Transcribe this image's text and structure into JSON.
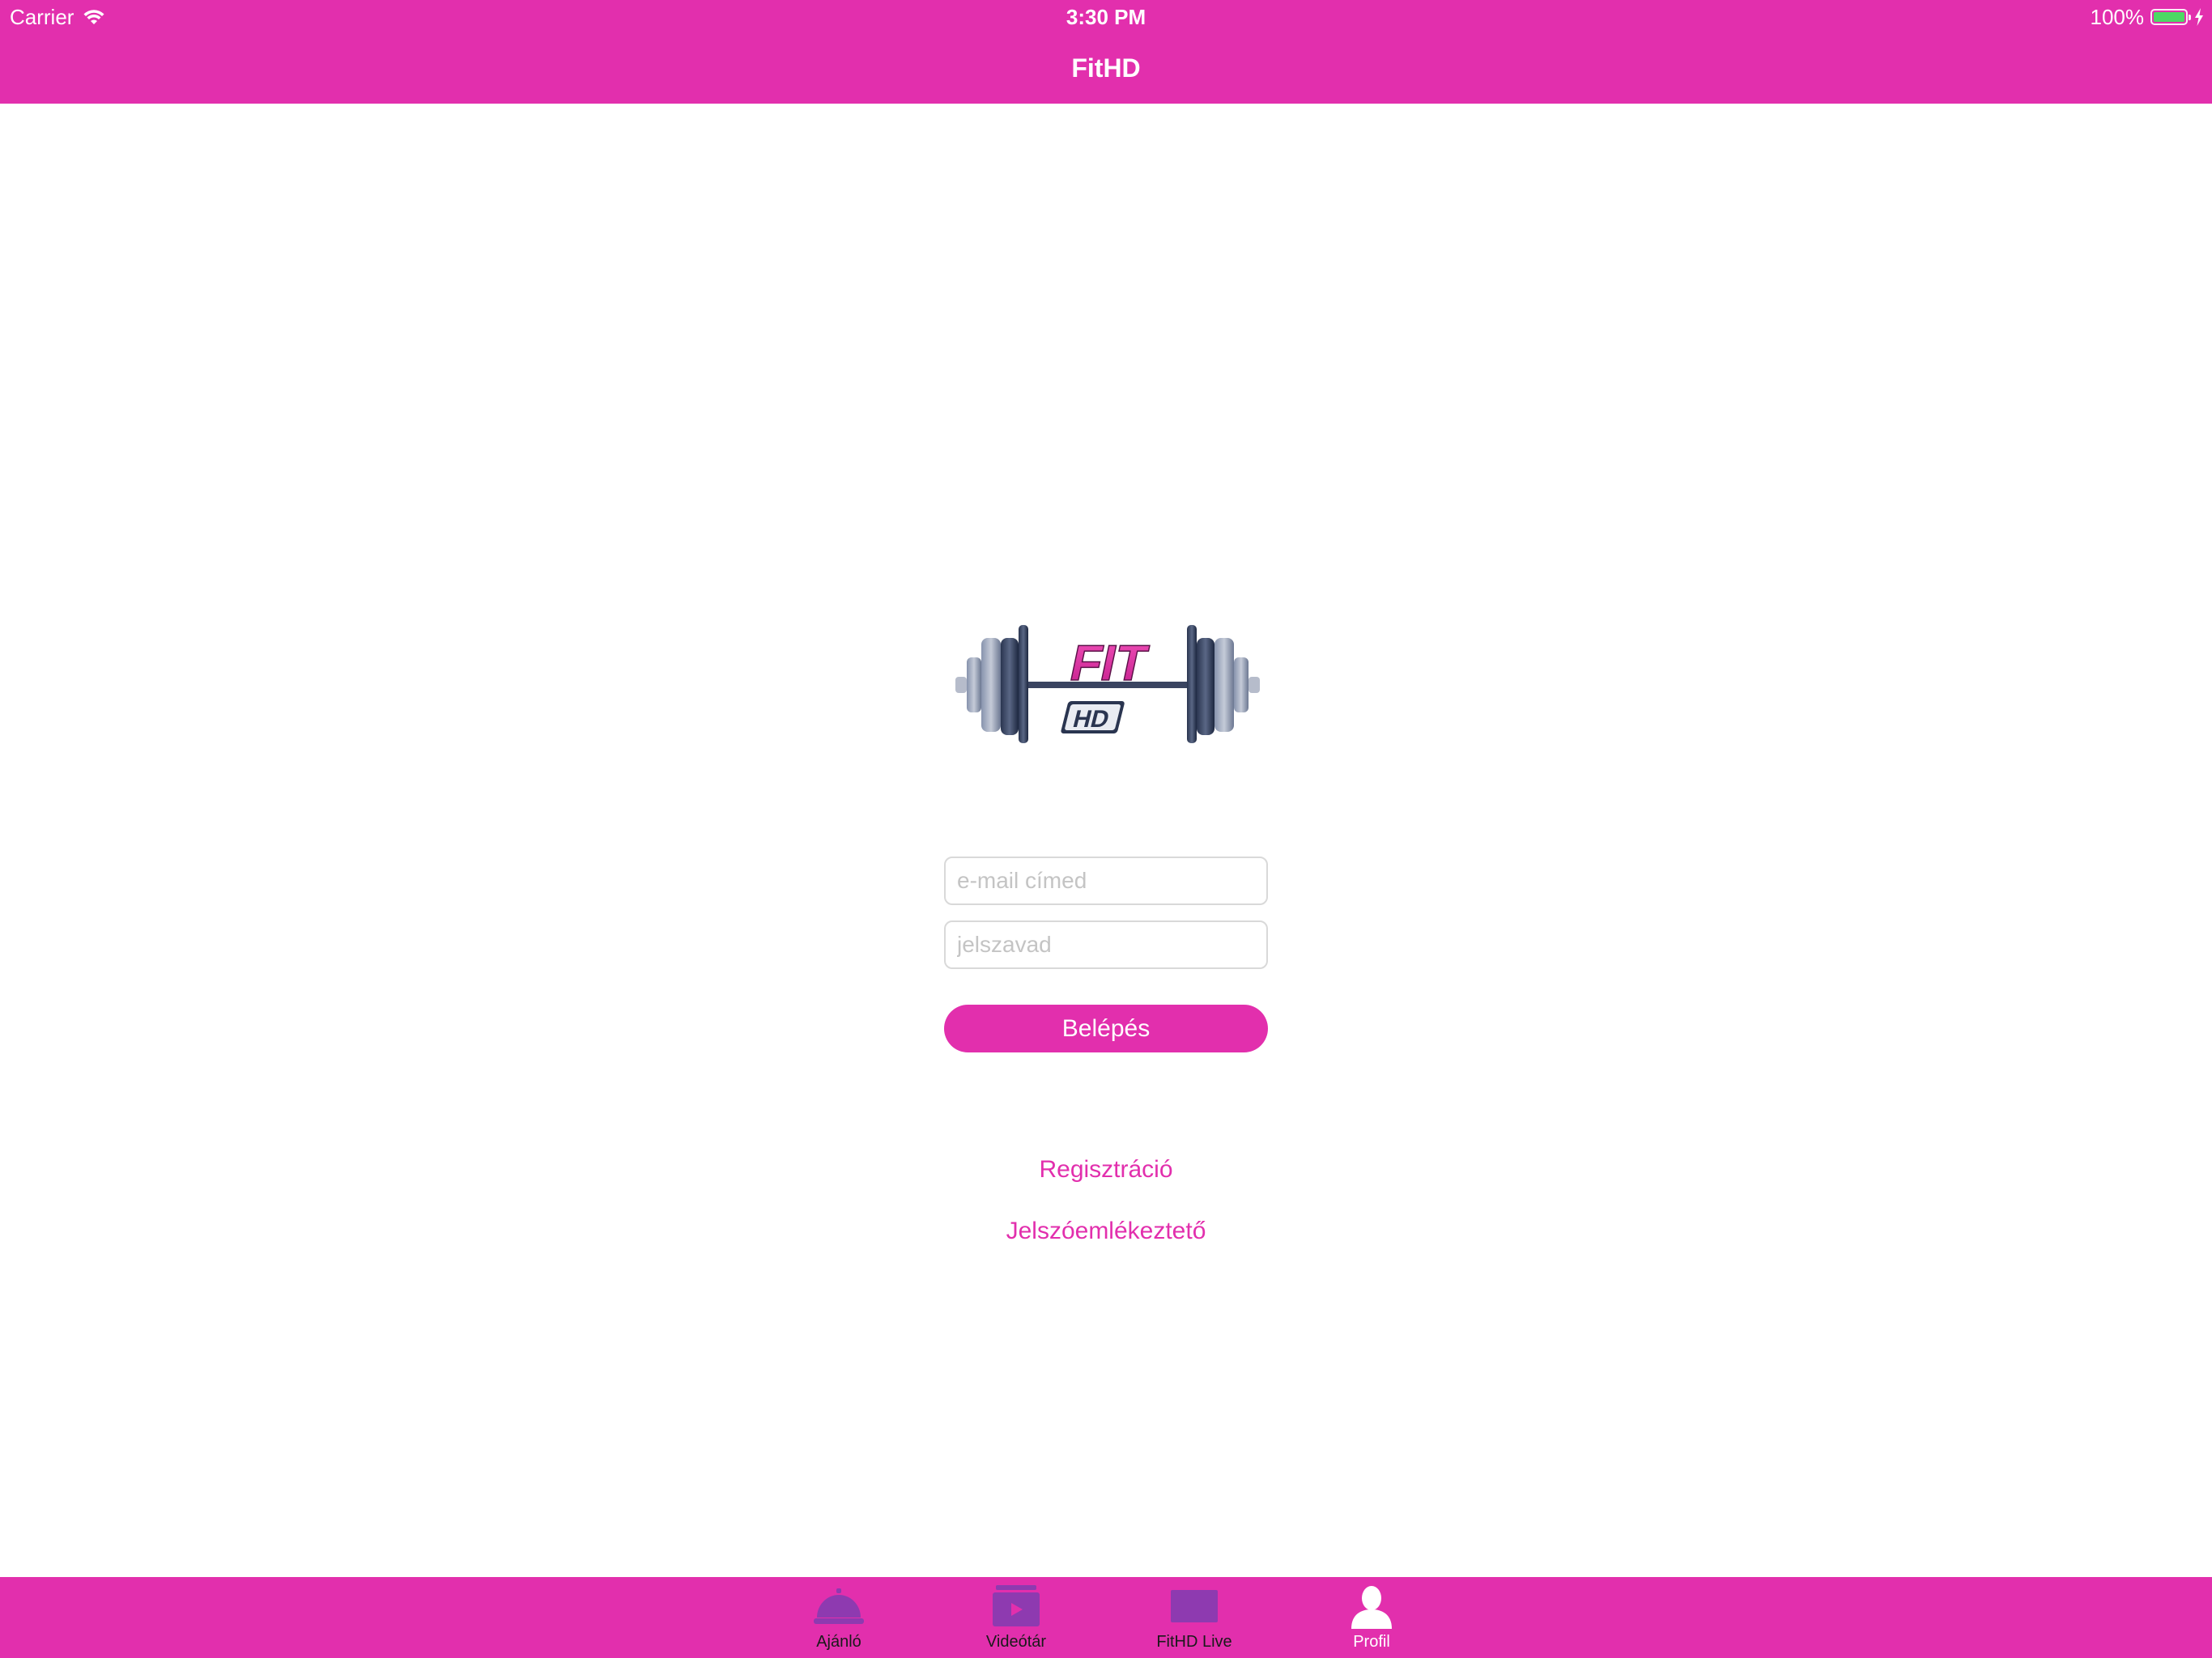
{
  "status_bar": {
    "carrier": "Carrier",
    "time": "3:30 PM",
    "battery": "100%",
    "battery_level": 1.0
  },
  "nav": {
    "title": "FitHD"
  },
  "logo": {
    "icon": "fithd-barbell-logo"
  },
  "form": {
    "email_placeholder": "e-mail címed",
    "email_value": "",
    "password_placeholder": "jelszavad",
    "password_value": "",
    "login_label": "Belépés"
  },
  "links": {
    "register": "Regisztráció",
    "forgot_password": "Jelszóemlékeztető"
  },
  "tabs": [
    {
      "label": "Ajánló",
      "icon": "service-bell-icon"
    },
    {
      "label": "Videótár",
      "icon": "video-library-icon"
    },
    {
      "label": "FitHD Live",
      "icon": "live-screen-icon"
    },
    {
      "label": "Profil",
      "icon": "profile-icon",
      "active": true
    }
  ],
  "colors": {
    "brand": "#e22fad",
    "tab_icon": "#8e3ab0",
    "battery": "#4cd964"
  }
}
